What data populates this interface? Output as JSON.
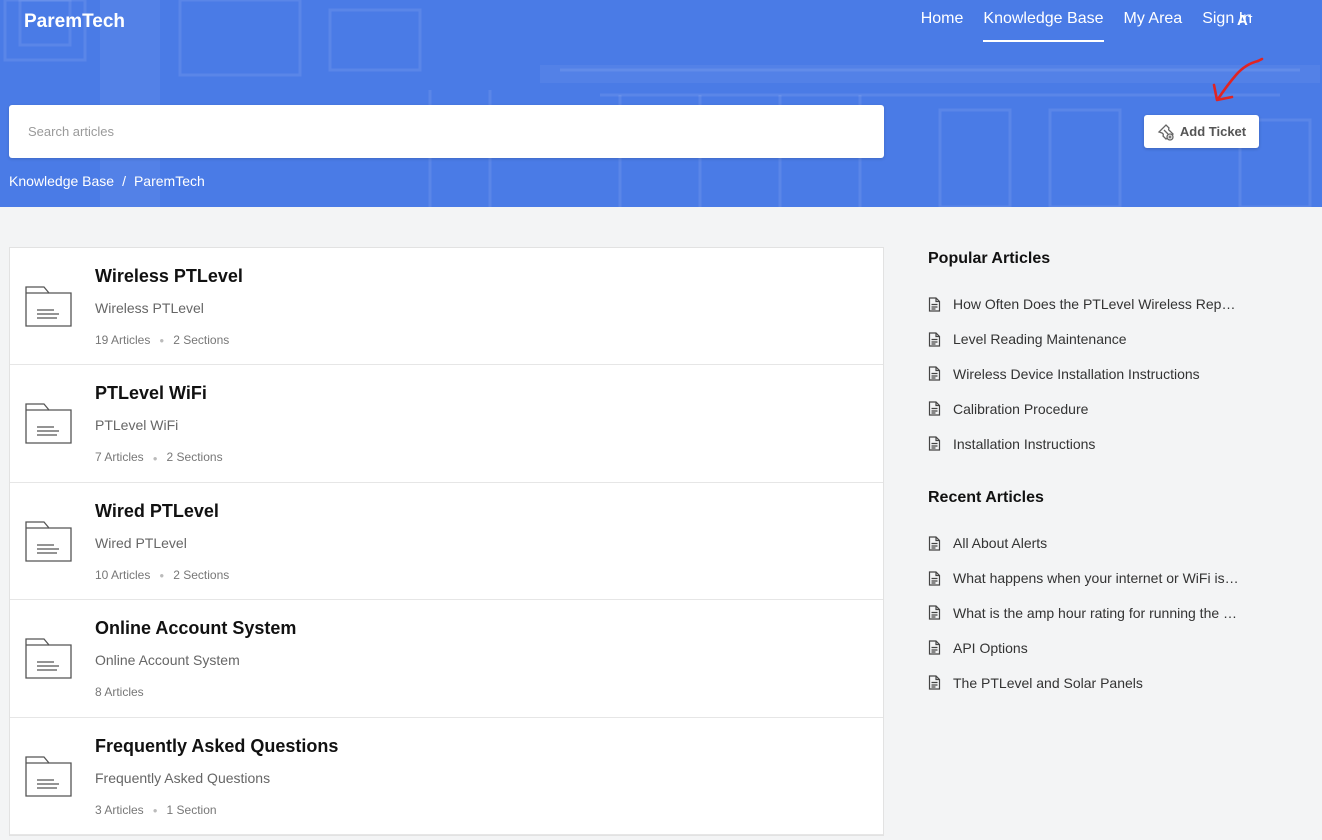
{
  "brand": "ParemTech",
  "nav": {
    "home": "Home",
    "knowledge_base": "Knowledge Base",
    "my_area": "My Area",
    "sign_in": "Sign In",
    "accessibility": "A"
  },
  "search": {
    "placeholder": "Search articles"
  },
  "add_ticket": {
    "label": "Add Ticket"
  },
  "breadcrumb": {
    "root": "Knowledge Base",
    "separator": "/",
    "current": "ParemTech"
  },
  "categories": [
    {
      "title": "Wireless PTLevel",
      "subtitle": "Wireless PTLevel",
      "articles": "19 Articles",
      "sections": "2 Sections"
    },
    {
      "title": "PTLevel WiFi",
      "subtitle": "PTLevel WiFi",
      "articles": "7 Articles",
      "sections": "2 Sections"
    },
    {
      "title": "Wired PTLevel",
      "subtitle": "Wired PTLevel",
      "articles": "10 Articles",
      "sections": "2 Sections"
    },
    {
      "title": "Online Account System",
      "subtitle": "Online Account System",
      "articles": "8 Articles",
      "sections": ""
    },
    {
      "title": "Frequently Asked Questions",
      "subtitle": "Frequently Asked Questions",
      "articles": "3 Articles",
      "sections": "1 Section"
    }
  ],
  "popular": {
    "title": "Popular Articles",
    "items": [
      "How Often Does the PTLevel Wireless Report?",
      "Level Reading Maintenance",
      "Wireless Device Installation Instructions",
      "Calibration Procedure",
      "Installation Instructions"
    ]
  },
  "recent": {
    "title": "Recent Articles",
    "items": [
      "All About Alerts",
      "What happens when your internet or WiFi is down?",
      "What is the amp hour rating for running the device?",
      "API Options",
      "The PTLevel and Solar Panels"
    ]
  },
  "colors": {
    "header_blue": "#4a7be6",
    "annotation_red": "#e02424"
  }
}
